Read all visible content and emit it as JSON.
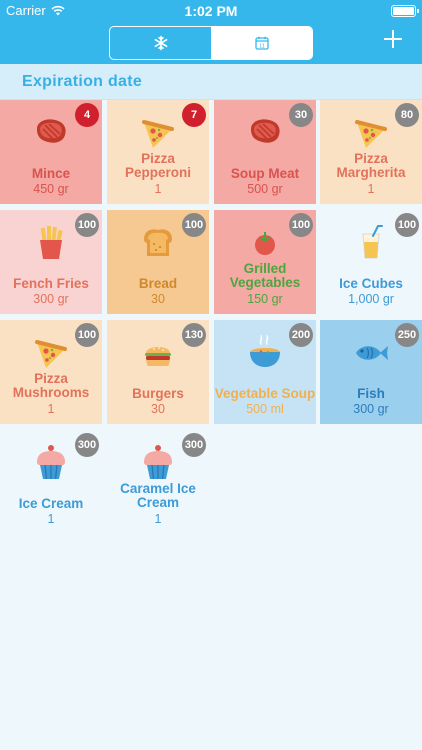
{
  "status_bar": {
    "carrier": "Carrier",
    "time": "1:02 PM"
  },
  "nav": {
    "left_segment_icon": "snowflake-icon",
    "right_segment_icon": "calendar-icon",
    "calendar_day": "11",
    "add_icon": "plus-icon"
  },
  "colors": {
    "accent": "#36b7ec",
    "badge_gray": "#878787",
    "badge_red": "#d0202d"
  },
  "section": {
    "title": "Expiration date"
  },
  "items": [
    {
      "name_lines": [
        "Mince"
      ],
      "quantity": "450 gr",
      "badge": "4",
      "badge_color": "#d0202d",
      "icon": "meat-icon",
      "bg": "#f4a9a4",
      "text_color": "#d9534f"
    },
    {
      "name_lines": [
        "Pizza",
        "Pepperoni"
      ],
      "quantity": "1",
      "badge": "7",
      "badge_color": "#d0202d",
      "icon": "pizza-icon",
      "bg": "#fbe1c3",
      "text_color": "#e2725b"
    },
    {
      "name_lines": [
        "Soup Meat"
      ],
      "quantity": "500 gr",
      "badge": "30",
      "badge_color": "#878787",
      "icon": "meat-icon",
      "bg": "#f4a9a4",
      "text_color": "#d9534f"
    },
    {
      "name_lines": [
        "Pizza",
        "Margherita"
      ],
      "quantity": "1",
      "badge": "80",
      "badge_color": "#878787",
      "icon": "pizza-icon",
      "bg": "#fbe1c3",
      "text_color": "#e2725b"
    },
    {
      "name_lines": [
        "Fench Fries"
      ],
      "quantity": "300 gr",
      "badge": "100",
      "badge_color": "#878787",
      "icon": "fries-icon",
      "bg": "#f8d3d1",
      "text_color": "#e2725b"
    },
    {
      "name_lines": [
        "Bread"
      ],
      "quantity": "30",
      "badge": "100",
      "badge_color": "#878787",
      "icon": "bread-icon",
      "bg": "#f6c993",
      "text_color": "#d0882b"
    },
    {
      "name_lines": [
        "Grilled",
        "Vegetables"
      ],
      "quantity": "150 gr",
      "badge": "100",
      "badge_color": "#878787",
      "icon": "tomato-icon",
      "bg": "#f4a9a4",
      "text_color": "#4ca63e"
    },
    {
      "name_lines": [
        "Ice Cubes"
      ],
      "quantity": "1,000 gr",
      "badge": "100",
      "badge_color": "#878787",
      "icon": "glass-icon",
      "bg": "#eef7fc",
      "text_color": "#3d9bd6"
    },
    {
      "name_lines": [
        "Pizza",
        "Mushrooms"
      ],
      "quantity": "1",
      "badge": "100",
      "badge_color": "#878787",
      "icon": "pizza-icon",
      "bg": "#fbe1c3",
      "text_color": "#e2725b"
    },
    {
      "name_lines": [
        "Burgers"
      ],
      "quantity": "30",
      "badge": "130",
      "badge_color": "#878787",
      "icon": "burger-icon",
      "bg": "#fbe1c3",
      "text_color": "#e2725b"
    },
    {
      "name_lines": [
        "Vegetable Soup"
      ],
      "quantity": "500 ml",
      "badge": "200",
      "badge_color": "#878787",
      "icon": "soup-bowl-icon",
      "bg": "#c6e3f5",
      "text_color": "#f1b04d"
    },
    {
      "name_lines": [
        "Fish"
      ],
      "quantity": "300 gr",
      "badge": "250",
      "badge_color": "#878787",
      "icon": "fish-icon",
      "bg": "#9bcfee",
      "text_color": "#2c7dbd"
    },
    {
      "name_lines": [
        "Ice Cream"
      ],
      "quantity": "1",
      "badge": "300",
      "badge_color": "#878787",
      "icon": "cupcake-icon",
      "bg": "#eef7fc",
      "text_color": "#3d9bd6"
    },
    {
      "name_lines": [
        "Caramel Ice",
        "Cream"
      ],
      "quantity": "1",
      "badge": "300",
      "badge_color": "#878787",
      "icon": "cupcake-icon",
      "bg": "#eef7fc",
      "text_color": "#3d9bd6"
    }
  ]
}
